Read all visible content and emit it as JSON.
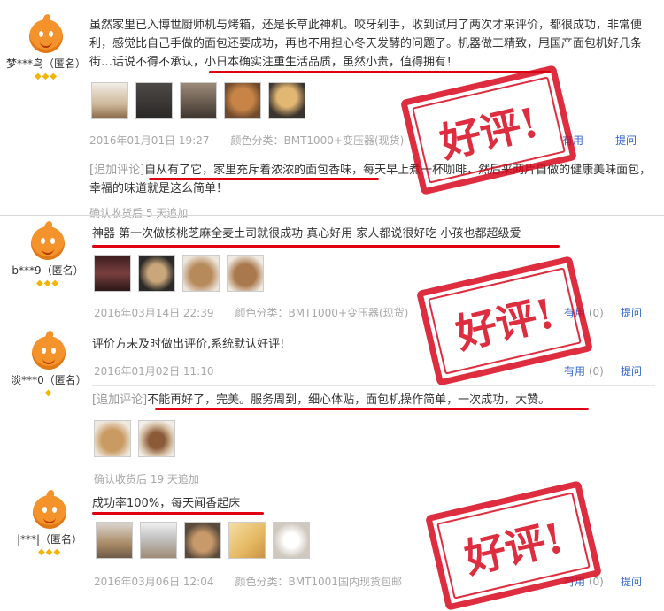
{
  "reviews": [
    {
      "user": "梦***鸟（匿名）",
      "text": "虽然家里已入博世厨师机与烤箱，还是长草此神机。咬牙剁手，收到试用了两次才来评价，都很成功，非常便利，感觉比自己手做的面包还要成功，再也不用担心冬天发酵的问题了。机器做工精致，甩国产面包机好几条街…话说不得不承认，小日本确实注重生活品质，虽然小贵，值得拥有！",
      "date": "2016年01月01日 19:27",
      "color": "颜色分类：BMT1000+变压器(现货)",
      "helpful": "有用",
      "ask": "提问",
      "add_tag": "[追加评论]",
      "add_text": "自从有了它，家里充斥着浓浓的面包香味，每天早上煮一杯咖啡，然后来两片自做的健康美味面包，幸福的味道就是这么简单！",
      "confirm": "确认收货后 5 天追加",
      "stamp": "好评!"
    },
    {
      "user": "b***9（匿名）",
      "text": "神器 第一次做核桃芝麻全麦土司就很成功 真心好用 家人都说很好吃 小孩也都超级爱",
      "date": "2016年03月14日 22:39",
      "color": "颜色分类：BMT1000+变压器(现货)",
      "helpful": "有用",
      "helpful_count": "(0)",
      "ask": "提问",
      "stamp": "好评!"
    },
    {
      "user": "淡***0（匿名）",
      "text": "评价方未及时做出评价,系统默认好评!",
      "date": "2016年01月02日 11:10",
      "helpful": "有用",
      "helpful_count": "(0)",
      "ask": "提问",
      "add_tag": "[追加评论]",
      "add_text": "不能再好了，完美。服务周到，细心体贴，面包机操作简单，一次成功，大赞。",
      "confirm": "确认收货后 19 天追加"
    },
    {
      "user": "|***|（匿名）",
      "text": "成功率100%，每天闻香起床",
      "date": "2016年03月06日 12:04",
      "color": "颜色分类：BMT1001国内现货包邮",
      "helpful": "有用",
      "helpful_count": "(0)",
      "ask": "提问",
      "stamp": "好评!"
    }
  ]
}
